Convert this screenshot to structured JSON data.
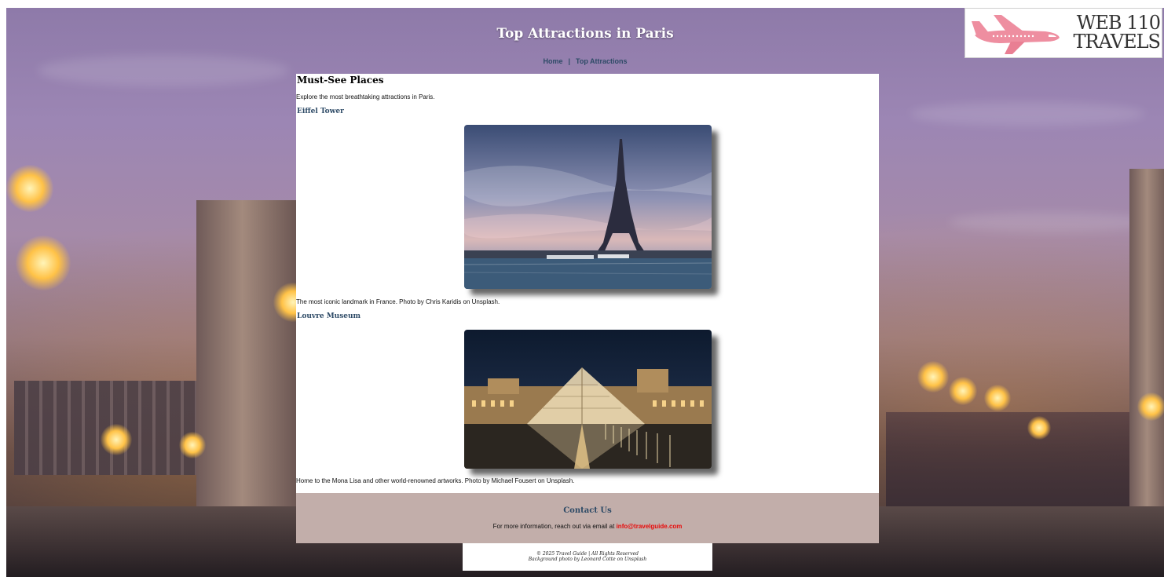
{
  "header": {
    "title": "Top Attractions in Paris",
    "nav": [
      {
        "label": "Home"
      },
      {
        "label": "Top Attractions"
      }
    ],
    "nav_separator": "|"
  },
  "logo": {
    "line1": "WEB 110",
    "line2": "TRAVELS",
    "icon": "airplane-icon",
    "icon_color": "#ee8ea0"
  },
  "main": {
    "heading": "Must-See Places",
    "intro": "Explore the most breathtaking attractions in Paris.",
    "attractions": [
      {
        "title": "Eiffel Tower",
        "caption": "The most iconic landmark in France. Photo by Chris Karidis on Unsplash."
      },
      {
        "title": "Louvre Museum",
        "caption": "Home to the Mona Lisa and other world-renowned artworks. Photo by Michael Fousert on Unsplash."
      }
    ]
  },
  "contact": {
    "heading": "Contact Us",
    "text": "For more information, reach out via email at",
    "email": "info@travelguide.com"
  },
  "footer": {
    "line1": "© 2025 Travel Guide | All Rights Reserved",
    "line2": "Background photo by Leonard Cotte on Unsplash"
  },
  "colors": {
    "accent": "#2d4a66",
    "email": "#e80a0a",
    "contact_bg": "#c2aeaa"
  }
}
